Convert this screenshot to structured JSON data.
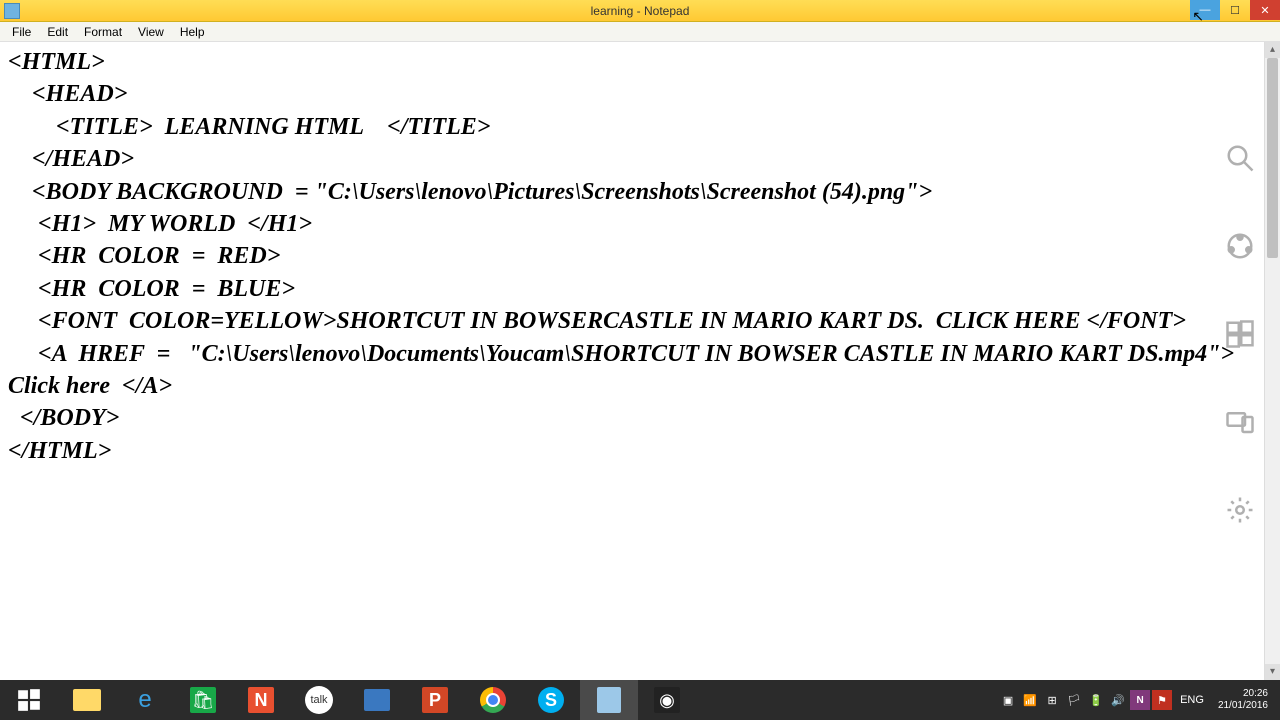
{
  "window": {
    "title": "learning - Notepad"
  },
  "menu": {
    "file": "File",
    "edit": "Edit",
    "format": "Format",
    "view": "View",
    "help": "Help"
  },
  "editor": {
    "content": "<HTML>\n    <HEAD>\n        <TITLE>  LEARNING HTML    </TITLE>\n    </HEAD>\n    <BODY BACKGROUND  = \"C:\\Users\\lenovo\\Pictures\\Screenshots\\Screenshot (54).png\">\n     <H1>  MY WORLD  </H1>\n     <HR  COLOR  =  RED>\n     <HR  COLOR  =  BLUE>\n     <FONT  COLOR=YELLOW>SHORTCUT IN BOWSERCASTLE IN MARIO KART DS.  CLICK HERE </FONT>\n     <A  HREF  =   \"C:\\Users\\lenovo\\Documents\\Youcam\\SHORTCUT IN BOWSER CASTLE IN MARIO KART DS.mp4\">  Click here  </A>\n  </BODY>\n</HTML>"
  },
  "tray": {
    "lang": "ENG",
    "time": "20:26",
    "date": "21/01/2016"
  }
}
